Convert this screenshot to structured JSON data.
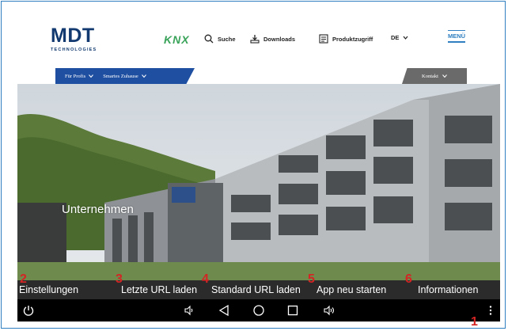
{
  "header": {
    "logo_main": "MDT",
    "logo_sub": "TECHNOLOGIES",
    "knx": "KNX",
    "search_label": "Suche",
    "downloads_label": "Downloads",
    "product_access_label": "Produktzugriff",
    "language_label": "DE",
    "menu_label": "MENÜ"
  },
  "subnav": {
    "items": [
      {
        "label": "Für Profis"
      },
      {
        "label": "Smartes Zuhause"
      }
    ],
    "right_label": "Kontakt"
  },
  "hero": {
    "title": "Unternehmen"
  },
  "overlay_menu": {
    "options": [
      {
        "number": "2",
        "label": "Einstellungen"
      },
      {
        "number": "3",
        "label": "Letzte URL laden"
      },
      {
        "number": "4",
        "label": "Standard URL laden"
      },
      {
        "number": "5",
        "label": "App neu starten"
      },
      {
        "number": "6",
        "label": "Informationen"
      }
    ]
  },
  "navbar": {
    "menu_number": "1",
    "icons": [
      "power-icon",
      "volume-down-icon",
      "back-icon",
      "home-icon",
      "recents-icon",
      "volume-up-icon",
      "overflow-menu-icon"
    ]
  },
  "colors": {
    "brand_blue": "#123a70",
    "bar_blue": "#1f4fa0",
    "knx_green": "#3aa35a",
    "annotation_red": "#d42424",
    "frame_blue": "#2f7fc1"
  }
}
